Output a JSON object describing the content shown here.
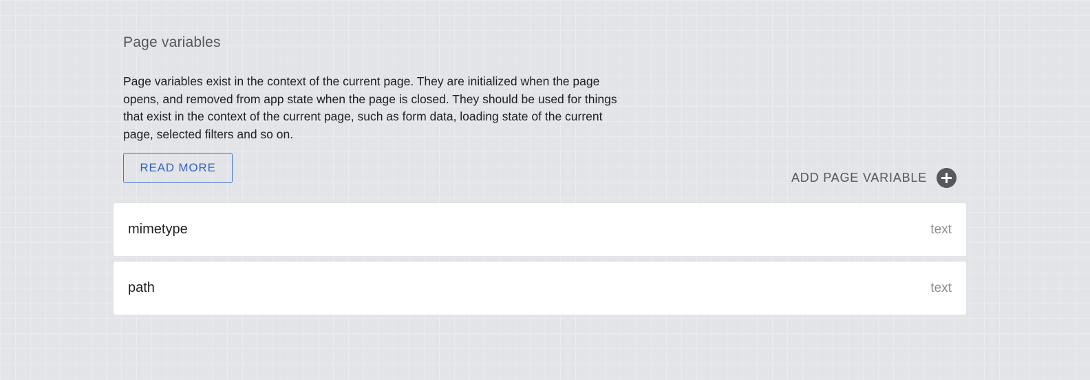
{
  "section": {
    "title": "Page variables",
    "description": "Page variables exist in the context of the current page. They are initialized when the page opens, and removed from app state when the page is closed. They should be used for things that exist in the context of the current page, such as form data, loading state of the current page, selected filters and so on.",
    "read_more_label": "READ MORE",
    "add_variable_label": "ADD PAGE VARIABLE",
    "add_icon": "plus-circle-icon"
  },
  "variables": [
    {
      "name": "mimetype",
      "type": "text"
    },
    {
      "name": "path",
      "type": "text"
    }
  ],
  "colors": {
    "background": "#e3e4e8",
    "accent": "#2f63c4",
    "icon": "#56585e",
    "row_background": "#ffffff"
  }
}
